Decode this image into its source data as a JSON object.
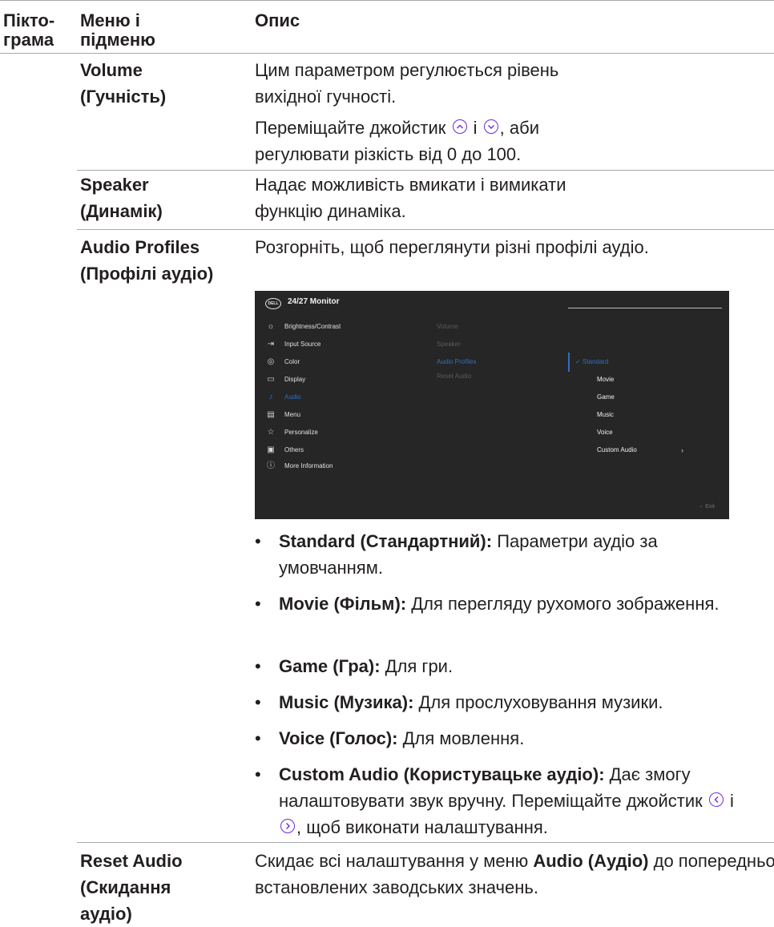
{
  "header": {
    "col1": "Пікто-грама",
    "col1_line1": "Пікто-",
    "col1_line2": "грама",
    "col2_line1": "Меню і",
    "col2_line2": "підменю",
    "col3": "Опис"
  },
  "rows": {
    "volume": {
      "name_line1": "Volume",
      "name_line2": "(Гучність)",
      "desc1": "Цим параметром регулюється рівень вихідної гучності.",
      "desc2_before": "Переміщайте джойстик",
      "desc2_mid": "і",
      "desc2_after": ", аби регулювати різкість від 0 до 100."
    },
    "speaker": {
      "name_line1": "Speaker",
      "name_line2": "(Динамік)",
      "desc": "Надає можливість вмикати і вимикати функцію динаміка."
    },
    "audio_profiles": {
      "name_line1": "Audio Profiles",
      "name_line2": "(Профілі аудіо)",
      "desc": "Розгорніть, щоб переглянути різні профілі аудіо.",
      "bullets": [
        {
          "bold": "Standard (Стандартний):",
          "text": " Параметри аудіо за умовчанням."
        },
        {
          "bold": "Movie (Фільм):",
          "text": " Для перегляду рухомого зображення."
        },
        {
          "bold": "Game (Гра):",
          "text": " Для гри."
        },
        {
          "bold": "Music (Музика):",
          "text": " Для прослуховування музики."
        },
        {
          "bold": "Voice (Голос):",
          "text": " Для мовлення."
        },
        {
          "bold": "Custom Audio (Користувацьке аудіо):",
          "text": " Дає змогу налаштовувати звук вручну. Переміщайте джойстик",
          "text_mid": "і",
          "text_end": ", щоб виконати налаштування."
        }
      ]
    },
    "reset_audio": {
      "name_line1": "Reset Audio",
      "name_line2": "(Скидання",
      "name_line3": "аудіо)",
      "desc_before": "Скидає всі налаштування у меню ",
      "desc_bold": "Audio (Аудіо)",
      "desc_after": " до попередньо встановлених заводських значень."
    }
  },
  "osd": {
    "logo": "DELL",
    "title": "24/27 Monitor",
    "menu": [
      {
        "label": "Brightness/Contrast",
        "icon": "brightness-icon"
      },
      {
        "label": "Input Source",
        "icon": "input-source-icon"
      },
      {
        "label": "Color",
        "icon": "color-icon"
      },
      {
        "label": "Display",
        "icon": "display-icon"
      },
      {
        "label": "Audio",
        "icon": "audio-icon",
        "active": true
      },
      {
        "label": "Menu",
        "icon": "menu-icon"
      },
      {
        "label": "Personalize",
        "icon": "star-icon"
      },
      {
        "label": "Others",
        "icon": "others-icon"
      },
      {
        "label": "More Information",
        "icon": "info-icon"
      }
    ],
    "submenu": [
      "Volume",
      "Speaker",
      "Audio Profiles",
      "Reset Audio"
    ],
    "submenu_active": "Audio Profiles",
    "options": [
      "Standard",
      "Movie",
      "Game",
      "Music",
      "Voice",
      "Custom Audio"
    ],
    "option_selected": "Standard",
    "exit_label": "Exit",
    "accent_color": "#2f6ec4"
  }
}
